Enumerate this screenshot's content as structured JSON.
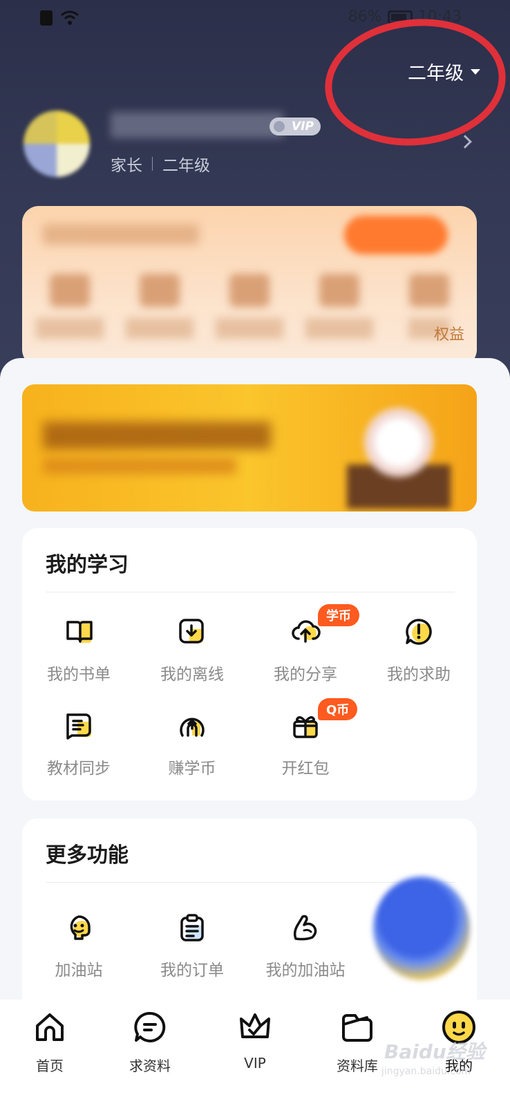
{
  "status_bar": {
    "battery": "86%",
    "time": "10:43"
  },
  "header": {
    "grade_selector": "二年级"
  },
  "profile": {
    "vip_label": "VIP",
    "role": "家长",
    "grade": "二年级"
  },
  "member_card": {
    "rights_label": "权益"
  },
  "study": {
    "title": "我的学习",
    "items": [
      {
        "label": "我的书单",
        "icon": "book-icon"
      },
      {
        "label": "我的离线",
        "icon": "download-icon"
      },
      {
        "label": "我的分享",
        "icon": "upload-cloud-icon",
        "badge": "学币"
      },
      {
        "label": "我的求助",
        "icon": "help-bubble-icon"
      },
      {
        "label": "教材同步",
        "icon": "textbook-icon"
      },
      {
        "label": "赚学币",
        "icon": "earn-coin-icon"
      },
      {
        "label": "开红包",
        "icon": "gift-icon",
        "badge": "Q币"
      }
    ]
  },
  "more": {
    "title": "更多功能",
    "items": [
      {
        "label": "加油站",
        "icon": "mascot-face-icon"
      },
      {
        "label": "我的订单",
        "icon": "clipboard-icon"
      },
      {
        "label": "我的加油站",
        "icon": "muscle-icon"
      }
    ]
  },
  "tabs": [
    {
      "label": "首页",
      "icon": "home-icon"
    },
    {
      "label": "求资料",
      "icon": "chat-icon"
    },
    {
      "label": "VIP",
      "icon": "crown-icon"
    },
    {
      "label": "资料库",
      "icon": "folder-icon"
    },
    {
      "label": "我的",
      "icon": "smiley-icon",
      "active": true
    }
  ],
  "watermark": {
    "text": "Baidu经验",
    "sub": "jingyan.baidu.com"
  },
  "colors": {
    "accent_orange": "#ff5a1f",
    "highlight_yellow": "#ffd84a",
    "header_bg": "#2b2f4a",
    "annotation_red": "#e0303a"
  }
}
